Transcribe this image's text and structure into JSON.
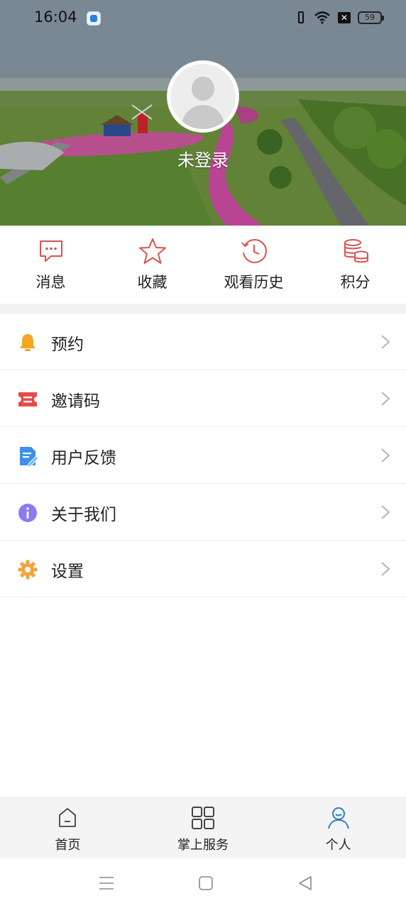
{
  "status_bar": {
    "time": "16:04",
    "battery_level": "59"
  },
  "profile": {
    "login_status": "未登录"
  },
  "quick_actions": [
    {
      "label": "消息",
      "icon": "message-icon"
    },
    {
      "label": "收藏",
      "icon": "star-icon"
    },
    {
      "label": "观看历史",
      "icon": "history-icon"
    },
    {
      "label": "积分",
      "icon": "points-icon"
    }
  ],
  "menu": [
    {
      "label": "预约",
      "icon": "bell-icon",
      "color": "#f5a623"
    },
    {
      "label": "邀请码",
      "icon": "ticket-icon",
      "color": "#e84a4a"
    },
    {
      "label": "用户反馈",
      "icon": "feedback-icon",
      "color": "#3d8fe8"
    },
    {
      "label": "关于我们",
      "icon": "info-icon",
      "color": "#8a7cf0"
    },
    {
      "label": "设置",
      "icon": "gear-icon",
      "color": "#f2a43a"
    }
  ],
  "tabbar": [
    {
      "label": "首页",
      "icon": "home-icon",
      "active": false
    },
    {
      "label": "掌上服务",
      "icon": "grid-icon",
      "active": false
    },
    {
      "label": "个人",
      "icon": "person-icon",
      "active": true
    }
  ],
  "colors": {
    "accent_red": "#d9534f",
    "active_tab": "#2b7fc9"
  }
}
